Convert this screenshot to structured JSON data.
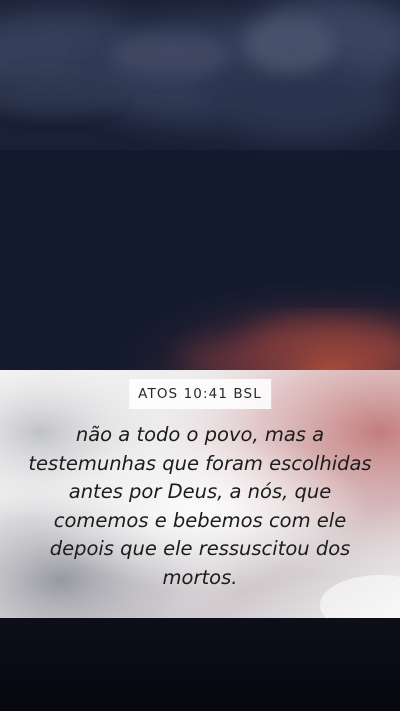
{
  "verse": {
    "reference": "ATOS 10:41 BSL",
    "text": "não a todo o povo, mas a testemunhas que foram escolhidas antes por Deus, a nós, que comemos e bebemos com ele depois que ele ressuscitou dos mortos."
  },
  "colors": {
    "sky_top": "#2c3550",
    "sky_bottom": "#0a0c18",
    "sunset_glow": "#b2503c",
    "band_light": "#f2f2f2",
    "band_pink": "#c27878",
    "pill_background": "#ffffff",
    "text": "#1c1c1c"
  }
}
